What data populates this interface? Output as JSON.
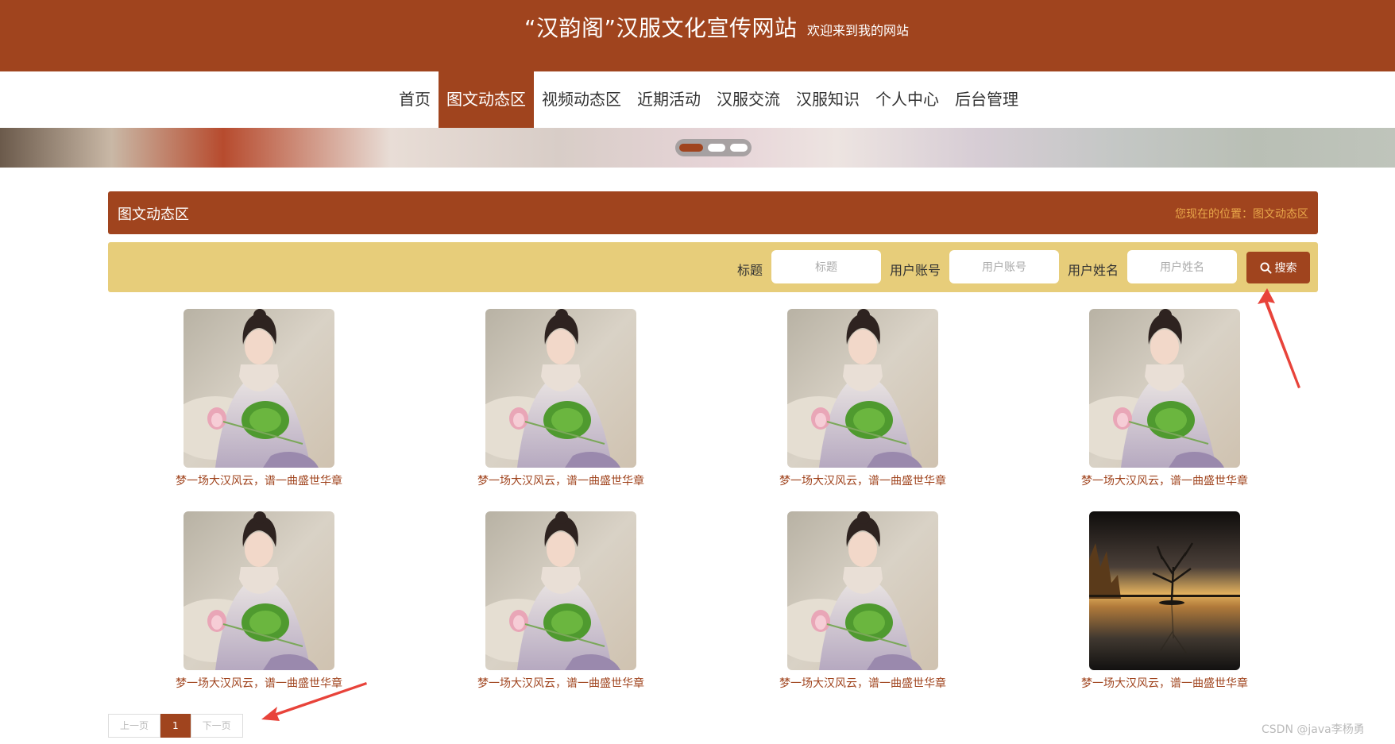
{
  "header": {
    "site_title": "“汉韵阁”汉服文化宣传网站",
    "welcome": "欢迎来到我的网站"
  },
  "nav": {
    "items": [
      {
        "label": "首页"
      },
      {
        "label": "图文动态区",
        "active": true
      },
      {
        "label": "视频动态区"
      },
      {
        "label": "近期活动"
      },
      {
        "label": "汉服交流"
      },
      {
        "label": "汉服知识"
      },
      {
        "label": "个人中心"
      },
      {
        "label": "后台管理"
      }
    ]
  },
  "banner": {
    "slides": 3,
    "active_slide": 1
  },
  "section": {
    "title": "图文动态区",
    "breadcrumb": "您现在的位置：图文动态区"
  },
  "search": {
    "fields": [
      {
        "label": "标题",
        "placeholder": "标题"
      },
      {
        "label": "用户账号",
        "placeholder": "用户账号"
      },
      {
        "label": "用户姓名",
        "placeholder": "用户姓名"
      }
    ],
    "button_label": "搜索"
  },
  "posts": [
    {
      "title": "梦一场大汉风云，谱一曲盛世华章",
      "image": "hanfu-woman-lotus"
    },
    {
      "title": "梦一场大汉风云，谱一曲盛世华章",
      "image": "hanfu-woman-lotus"
    },
    {
      "title": "梦一场大汉风云，谱一曲盛世华章",
      "image": "hanfu-woman-lotus"
    },
    {
      "title": "梦一场大汉风云，谱一曲盛世华章",
      "image": "hanfu-woman-lotus"
    },
    {
      "title": "梦一场大汉风云，谱一曲盛世华章",
      "image": "hanfu-woman-lotus"
    },
    {
      "title": "梦一场大汉风云，谱一曲盛世华章",
      "image": "hanfu-woman-lotus"
    },
    {
      "title": "梦一场大汉风云，谱一曲盛世华章",
      "image": "hanfu-woman-lotus"
    },
    {
      "title": "梦一场大汉风云，谱一曲盛世华章",
      "image": "lake-tree-sunset"
    }
  ],
  "pagination": {
    "prev": "上一页",
    "current": "1",
    "next": "下一页"
  },
  "watermark": "CSDN @java李杨勇",
  "colors": {
    "brand": "#a0441e",
    "search_bg": "#e7cd7a",
    "breadcrumb": "#e9a74a",
    "annotation_arrow": "#e8433a"
  }
}
